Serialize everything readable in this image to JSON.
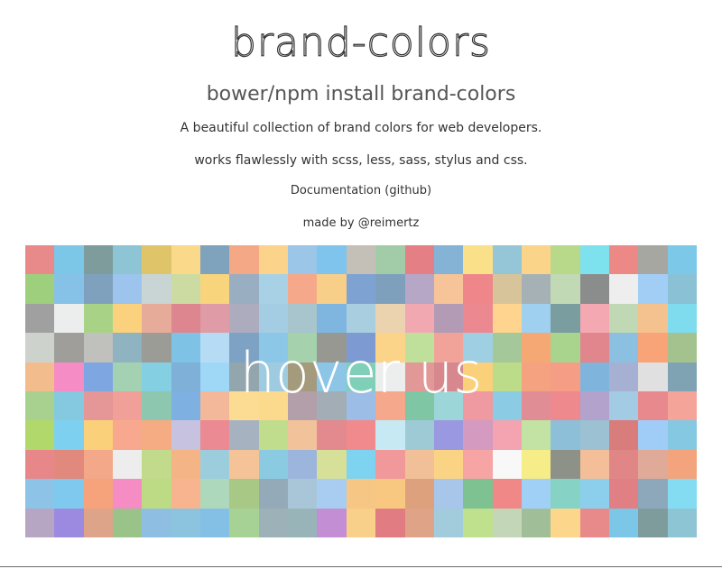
{
  "header": {
    "title": "brand-colors",
    "install_command": "bower/npm install brand-colors",
    "description": "A beautiful collection of brand colors for web developers.",
    "compatibility": "works flawlessly with scss, less, sass, stylus and css.",
    "documentation_link": "Documentation (github)",
    "made_by_prefix": "made by",
    "author_link": "@reimertz"
  },
  "swatches": {
    "overlay_text": "hover us",
    "palette": [
      "#e88a8a",
      "#7cc6e8",
      "#7f9c9c",
      "#8ec5d4",
      "#e0c46a",
      "#fad98a",
      "#7fa3bd",
      "#f5a886",
      "#fcd38a",
      "#9bc6e8",
      "#7ec4ec",
      "#c4c0b8",
      "#a2cca8",
      "#e57f86",
      "#84b3d6",
      "#fbe08a",
      "#94c6d8",
      "#fad488",
      "#b9d98a",
      "#7de2ee",
      "#ec8886",
      "#a7a7a2",
      "#7cc8e9",
      "#9ecf7c",
      "#86c2e8",
      "#7fa1be",
      "#9cc4ec",
      "#c9d4d4",
      "#cbdba2",
      "#f8d47c",
      "#9aaec2",
      "#a8d1e6",
      "#f6a88a",
      "#f8cf88",
      "#7ea3d2",
      "#7fa0bc",
      "#b6a7c6",
      "#f7c49a",
      "#ee868a",
      "#d8c49a",
      "#a6b1b6",
      "#c2d9b6",
      "#8b8d8d",
      "#eeeeee",
      "#a2cef5",
      "#8bc1d5",
      "#a0a0a0",
      "#eceeee",
      "#a8d386",
      "#fbd17e",
      "#e7ab9a",
      "#dd8690",
      "#df9ba6",
      "#adacbe",
      "#a4cde4",
      "#a8c4cc",
      "#7fb6e0",
      "#a9cee0",
      "#ebd3b0",
      "#f2a8b0",
      "#b39bb6",
      "#ec8890",
      "#fed48e",
      "#9fd0f0",
      "#7a9ea0",
      "#f3a8b2",
      "#c0d8b4",
      "#f4c28e",
      "#7edcee",
      "#cdd2cd",
      "#9f9e9b",
      "#c0c0bc",
      "#8fb3c0",
      "#9c9c96",
      "#7ec3e6",
      "#b5dbf5",
      "#7ea2c3",
      "#8cc7e8",
      "#a5d1ad",
      "#989892",
      "#7e9ad3",
      "#fbd48a",
      "#bfe09a",
      "#f1a39a",
      "#9ecfe2",
      "#a5c89a",
      "#f6a874",
      "#a8d48e",
      "#e1868c",
      "#8bc0e0",
      "#f8a478",
      "#a3c28e",
      "#f3bc8c",
      "#f68cc6",
      "#7ea6e0",
      "#a3d1b2",
      "#84cfe2",
      "#7fb0d8",
      "#9ed8f6",
      "#93a6ae",
      "#9fcbe0",
      "#a49a7c",
      "#8cc5e6",
      "#7fcfb9",
      "#eceeee",
      "#e39898",
      "#d7888e",
      "#fad07a",
      "#bddc8a",
      "#f4a280",
      "#f69d86",
      "#7fb5dc",
      "#a6b0d3",
      "#e0e0e0",
      "#7fa3b2",
      "#a8d08e",
      "#84c9e0",
      "#e59696",
      "#f0a098",
      "#8ec7b0",
      "#7eb0e2",
      "#f3b89a",
      "#fbdc92",
      "#fbda8e",
      "#b39faa",
      "#a3adb5",
      "#9cbde6",
      "#f6a88c",
      "#7ec6a4",
      "#9cd6d8",
      "#ee9aa0",
      "#8bcbe4",
      "#e18d96",
      "#ee8a8e",
      "#b2a2cc",
      "#a3cbe3",
      "#e8898d",
      "#f5a49a",
      "#b1d86a",
      "#7ed0f0",
      "#fbd07a",
      "#f8a88e",
      "#f5ac82",
      "#c7c2e0",
      "#eb8a92",
      "#a7b2c0",
      "#c0dd8e",
      "#f2c29a",
      "#e28a8e",
      "#f08a8c",
      "#c6e9f4",
      "#9ecad6",
      "#9a98e0",
      "#d49ac0",
      "#f3a4b0",
      "#c2e3a4",
      "#8ebfd8",
      "#9bc1d3",
      "#d97c7c",
      "#a0cdf8",
      "#85c8e2",
      "#e8878a",
      "#e2897d",
      "#f3a88a",
      "#ededed",
      "#c2da8c",
      "#f4b486",
      "#9bcddc",
      "#f4c498",
      "#8acbe2",
      "#9cb5dc",
      "#d6e098",
      "#7ed3f0",
      "#f0989a",
      "#f2c098",
      "#fad484",
      "#f6a4a4",
      "#f8f8f8",
      "#f6ec88",
      "#8d9188",
      "#f4bf98",
      "#e18686",
      "#e0aa98",
      "#f3a47c",
      "#8cc3e6",
      "#7fc9ef",
      "#f6a37c",
      "#f58cc4",
      "#bcdb84",
      "#f7b48e",
      "#aed8bc",
      "#a8c886",
      "#95aab8",
      "#a9c6d8",
      "#a9cdf0",
      "#f6c784",
      "#f8c880",
      "#dea17e",
      "#a8c6ea",
      "#7fc291",
      "#f08888",
      "#a0d0f6",
      "#86d3c6",
      "#8ccfec",
      "#e08084",
      "#8da8ba",
      "#83dcf2",
      "#b6a6c4",
      "#9c8ae0",
      "#dda48a",
      "#9ac38a",
      "#8ebfe2",
      "#8cc4e0",
      "#84c0e6",
      "#a6d296",
      "#9db1b9",
      "#98b4b8",
      "#c48ed4",
      "#f8d08a",
      "#e07c82",
      "#dfa488",
      "#a2ccdc",
      "#bfe08c",
      "#c4d6b8",
      "#a0be98",
      "#fcd68a"
    ]
  }
}
